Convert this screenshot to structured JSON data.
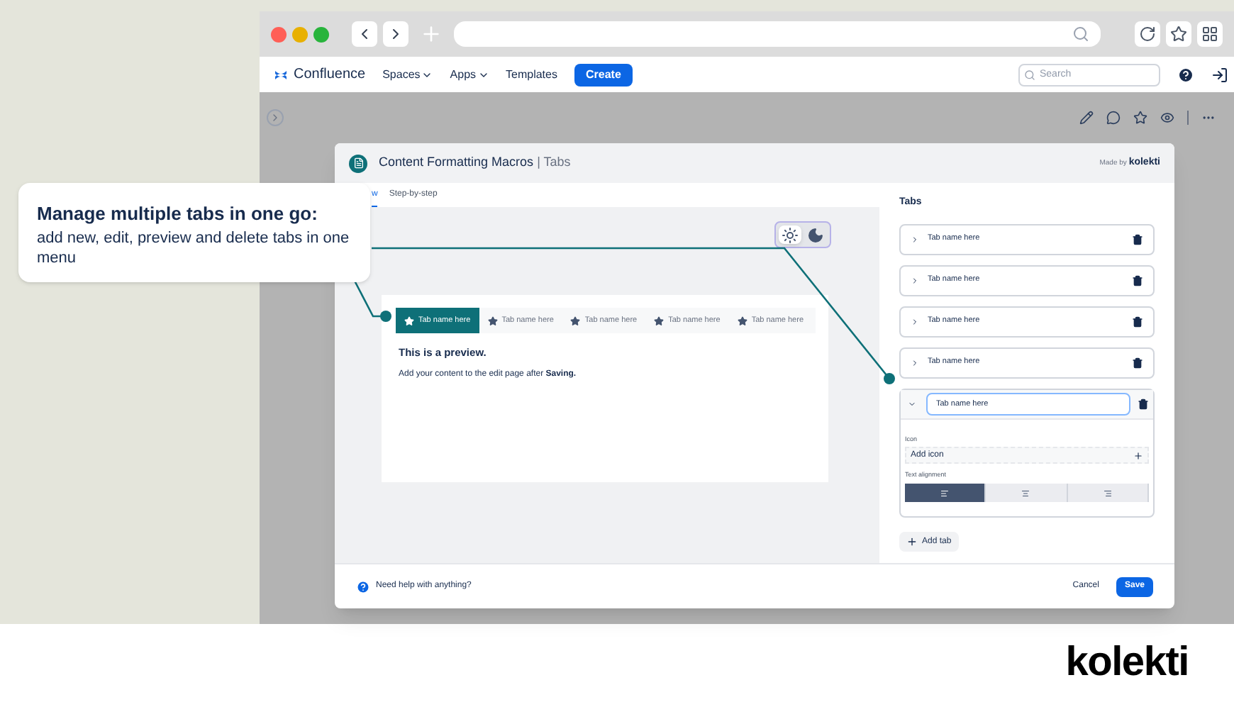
{
  "callout": {
    "title": "Manage multiple tabs in one go:",
    "text": "add new, edit, preview and delete tabs in one menu"
  },
  "nav": {
    "brand": "Confluence",
    "menus": [
      {
        "label": "Spaces",
        "dropdown": true
      },
      {
        "label": "Apps",
        "dropdown": true
      },
      {
        "label": "Templates",
        "dropdown": false
      }
    ],
    "create": "Create",
    "search_placeholder": "Search"
  },
  "modal": {
    "title": "Content Formatting Macros",
    "subtitle": "| Tabs",
    "made_by": "Made by",
    "made_by_brand": "kolekti",
    "view_tabs": [
      {
        "label": "w",
        "selected": true
      },
      {
        "label": "Step-by-step",
        "selected": false
      }
    ],
    "theme": [
      {
        "kind": "light",
        "selected": true
      },
      {
        "kind": "dark",
        "selected": false
      }
    ],
    "preview": {
      "tabs": [
        {
          "label": "Tab name here",
          "selected": true
        },
        {
          "label": "Tab name here",
          "selected": false
        },
        {
          "label": "Tab name here",
          "selected": false
        },
        {
          "label": "Tab name here",
          "selected": false
        },
        {
          "label": "Tab name here",
          "selected": false
        }
      ],
      "heading": "This is a preview.",
      "body": "Add your content to the edit page after **Saving.**"
    },
    "panel": {
      "title": "Tabs",
      "items": [
        {
          "name": "Tab name here",
          "expanded": false
        },
        {
          "name": "Tab name here",
          "expanded": false
        },
        {
          "name": "Tab name here",
          "expanded": false
        },
        {
          "name": "Tab name here",
          "expanded": false
        },
        {
          "name": "Tab name here",
          "expanded": true
        }
      ],
      "icon_label": "Icon",
      "add_icon": "Add icon",
      "alignment_label": "Text alignment",
      "alignments": [
        {
          "kind": "left",
          "selected": true
        },
        {
          "kind": "center",
          "selected": false
        },
        {
          "kind": "right",
          "selected": false
        }
      ],
      "add_tab": "Add tab"
    },
    "footer": {
      "help": "Need help with anything?",
      "cancel": "Cancel",
      "save": "Save"
    }
  },
  "brand": "kolekti"
}
